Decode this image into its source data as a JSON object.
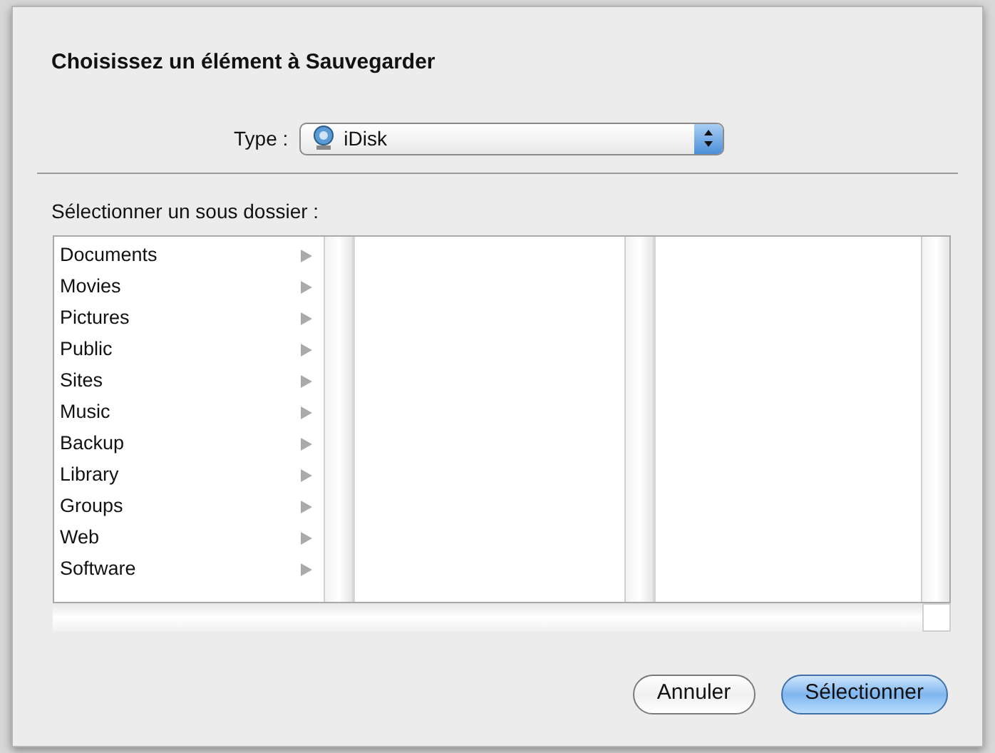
{
  "dialog": {
    "title": "Choisissez un élément à Sauvegarder"
  },
  "type_selector": {
    "label": "Type :",
    "value": "iDisk"
  },
  "browser": {
    "label": "Sélectionner un sous dossier :",
    "items": [
      {
        "name": "Documents",
        "has_children": true
      },
      {
        "name": "Movies",
        "has_children": true
      },
      {
        "name": "Pictures",
        "has_children": true
      },
      {
        "name": "Public",
        "has_children": true
      },
      {
        "name": "Sites",
        "has_children": true
      },
      {
        "name": "Music",
        "has_children": true
      },
      {
        "name": "Backup",
        "has_children": true
      },
      {
        "name": "Library",
        "has_children": true
      },
      {
        "name": "Groups",
        "has_children": true
      },
      {
        "name": "Web",
        "has_children": true
      },
      {
        "name": "Software",
        "has_children": true
      }
    ]
  },
  "buttons": [
    {
      "label": "Annuler",
      "kind": "cancel"
    },
    {
      "label": "Sélectionner",
      "kind": "default"
    }
  ]
}
